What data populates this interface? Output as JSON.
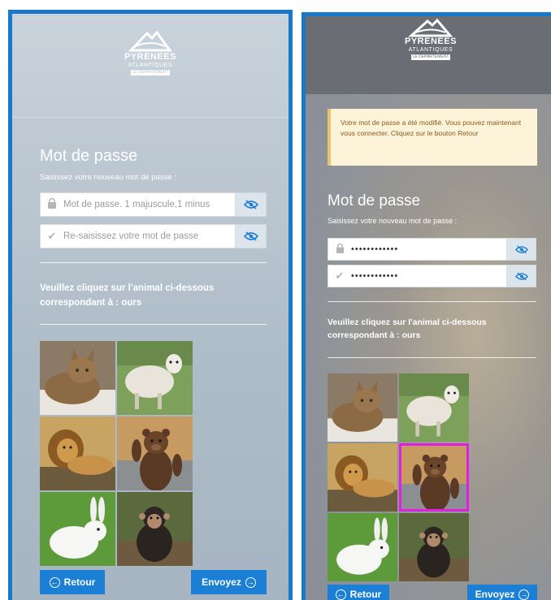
{
  "logo": {
    "line1": "PYRENEES",
    "line2": "ATLANTIQUES",
    "line3": "LE DÉPARTEMENT"
  },
  "left": {
    "title": "Mot de passe",
    "subtitle": "Saisissez votre nouveau mot de passe :",
    "password_placeholder": "Mot de passe. 1 majuscule,1 minus",
    "confirm_placeholder": "Re-saisissez votre mot de passe",
    "instruction_prefix": "Veuillez cliquez sur l'animal ci-dessous correspondant à : ",
    "instruction_animal": "ours",
    "back_label": "Retour",
    "send_label": "Envoyez"
  },
  "right": {
    "notice": "Votre mot de passe a été modifié. Vous pouvez maintenant vous connecter. Cliquez sur le bouton Retour",
    "title": "Mot de passe",
    "subtitle": "Saisissez votre nouveau mot de passe :",
    "password_value": "••••••••••••",
    "confirm_value": "••••••••••••",
    "instruction_prefix": "Veuillez cliquez sur l'animal ci-dessous correspondant à : ",
    "instruction_animal": "ours",
    "back_label": "Retour",
    "send_label": "Envoyez",
    "selected_animal": "bear"
  },
  "animals": [
    "cat",
    "sheep",
    "lion",
    "bear",
    "rabbit",
    "chimpanzee"
  ],
  "colors": {
    "accent": "#1c7fd6",
    "frame": "#1a78c8",
    "selection": "#e11ee6",
    "notice_bg": "#fdf3d8"
  }
}
